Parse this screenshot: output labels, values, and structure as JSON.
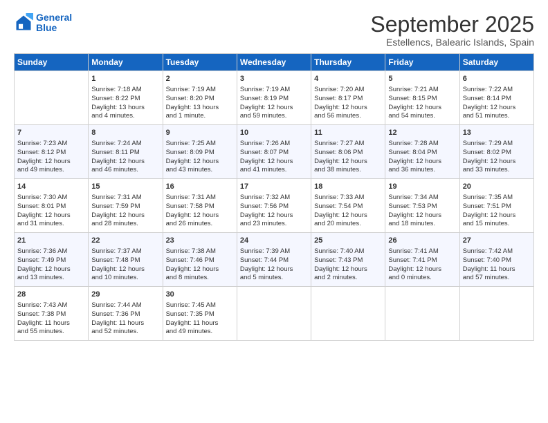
{
  "logo": {
    "line1": "General",
    "line2": "Blue"
  },
  "title": "September 2025",
  "subtitle": "Estellencs, Balearic Islands, Spain",
  "days_header": [
    "Sunday",
    "Monday",
    "Tuesday",
    "Wednesday",
    "Thursday",
    "Friday",
    "Saturday"
  ],
  "weeks": [
    [
      {
        "day": "",
        "info": ""
      },
      {
        "day": "1",
        "info": "Sunrise: 7:18 AM\nSunset: 8:22 PM\nDaylight: 13 hours\nand 4 minutes."
      },
      {
        "day": "2",
        "info": "Sunrise: 7:19 AM\nSunset: 8:20 PM\nDaylight: 13 hours\nand 1 minute."
      },
      {
        "day": "3",
        "info": "Sunrise: 7:19 AM\nSunset: 8:19 PM\nDaylight: 12 hours\nand 59 minutes."
      },
      {
        "day": "4",
        "info": "Sunrise: 7:20 AM\nSunset: 8:17 PM\nDaylight: 12 hours\nand 56 minutes."
      },
      {
        "day": "5",
        "info": "Sunrise: 7:21 AM\nSunset: 8:15 PM\nDaylight: 12 hours\nand 54 minutes."
      },
      {
        "day": "6",
        "info": "Sunrise: 7:22 AM\nSunset: 8:14 PM\nDaylight: 12 hours\nand 51 minutes."
      }
    ],
    [
      {
        "day": "7",
        "info": "Sunrise: 7:23 AM\nSunset: 8:12 PM\nDaylight: 12 hours\nand 49 minutes."
      },
      {
        "day": "8",
        "info": "Sunrise: 7:24 AM\nSunset: 8:11 PM\nDaylight: 12 hours\nand 46 minutes."
      },
      {
        "day": "9",
        "info": "Sunrise: 7:25 AM\nSunset: 8:09 PM\nDaylight: 12 hours\nand 43 minutes."
      },
      {
        "day": "10",
        "info": "Sunrise: 7:26 AM\nSunset: 8:07 PM\nDaylight: 12 hours\nand 41 minutes."
      },
      {
        "day": "11",
        "info": "Sunrise: 7:27 AM\nSunset: 8:06 PM\nDaylight: 12 hours\nand 38 minutes."
      },
      {
        "day": "12",
        "info": "Sunrise: 7:28 AM\nSunset: 8:04 PM\nDaylight: 12 hours\nand 36 minutes."
      },
      {
        "day": "13",
        "info": "Sunrise: 7:29 AM\nSunset: 8:02 PM\nDaylight: 12 hours\nand 33 minutes."
      }
    ],
    [
      {
        "day": "14",
        "info": "Sunrise: 7:30 AM\nSunset: 8:01 PM\nDaylight: 12 hours\nand 31 minutes."
      },
      {
        "day": "15",
        "info": "Sunrise: 7:31 AM\nSunset: 7:59 PM\nDaylight: 12 hours\nand 28 minutes."
      },
      {
        "day": "16",
        "info": "Sunrise: 7:31 AM\nSunset: 7:58 PM\nDaylight: 12 hours\nand 26 minutes."
      },
      {
        "day": "17",
        "info": "Sunrise: 7:32 AM\nSunset: 7:56 PM\nDaylight: 12 hours\nand 23 minutes."
      },
      {
        "day": "18",
        "info": "Sunrise: 7:33 AM\nSunset: 7:54 PM\nDaylight: 12 hours\nand 20 minutes."
      },
      {
        "day": "19",
        "info": "Sunrise: 7:34 AM\nSunset: 7:53 PM\nDaylight: 12 hours\nand 18 minutes."
      },
      {
        "day": "20",
        "info": "Sunrise: 7:35 AM\nSunset: 7:51 PM\nDaylight: 12 hours\nand 15 minutes."
      }
    ],
    [
      {
        "day": "21",
        "info": "Sunrise: 7:36 AM\nSunset: 7:49 PM\nDaylight: 12 hours\nand 13 minutes."
      },
      {
        "day": "22",
        "info": "Sunrise: 7:37 AM\nSunset: 7:48 PM\nDaylight: 12 hours\nand 10 minutes."
      },
      {
        "day": "23",
        "info": "Sunrise: 7:38 AM\nSunset: 7:46 PM\nDaylight: 12 hours\nand 8 minutes."
      },
      {
        "day": "24",
        "info": "Sunrise: 7:39 AM\nSunset: 7:44 PM\nDaylight: 12 hours\nand 5 minutes."
      },
      {
        "day": "25",
        "info": "Sunrise: 7:40 AM\nSunset: 7:43 PM\nDaylight: 12 hours\nand 2 minutes."
      },
      {
        "day": "26",
        "info": "Sunrise: 7:41 AM\nSunset: 7:41 PM\nDaylight: 12 hours\nand 0 minutes."
      },
      {
        "day": "27",
        "info": "Sunrise: 7:42 AM\nSunset: 7:40 PM\nDaylight: 11 hours\nand 57 minutes."
      }
    ],
    [
      {
        "day": "28",
        "info": "Sunrise: 7:43 AM\nSunset: 7:38 PM\nDaylight: 11 hours\nand 55 minutes."
      },
      {
        "day": "29",
        "info": "Sunrise: 7:44 AM\nSunset: 7:36 PM\nDaylight: 11 hours\nand 52 minutes."
      },
      {
        "day": "30",
        "info": "Sunrise: 7:45 AM\nSunset: 7:35 PM\nDaylight: 11 hours\nand 49 minutes."
      },
      {
        "day": "",
        "info": ""
      },
      {
        "day": "",
        "info": ""
      },
      {
        "day": "",
        "info": ""
      },
      {
        "day": "",
        "info": ""
      }
    ]
  ]
}
